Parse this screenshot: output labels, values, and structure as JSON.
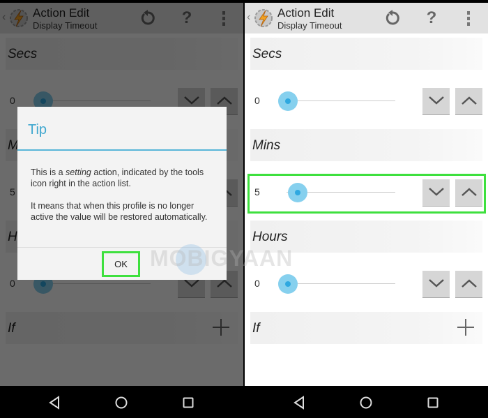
{
  "actionbar": {
    "title": "Action Edit",
    "subtitle": "Display Timeout",
    "back_glyph": "‹",
    "help_glyph": "?"
  },
  "sections": {
    "secs": {
      "label": "Secs",
      "value": "0"
    },
    "mins": {
      "label": "Mins",
      "value": "5"
    },
    "hours": {
      "label": "Hours",
      "value": "0"
    },
    "if": {
      "label": "If"
    }
  },
  "dialog": {
    "title": "Tip",
    "body_pre": "This is a ",
    "body_em": "setting",
    "body_post": " action, indicated by the tools icon right in the action list.",
    "body_2": "It means that when this profile is no longer active the value will be restored automatically.",
    "ok_label": "OK"
  },
  "watermark": {
    "text": "MOBIGYAAN"
  },
  "colors": {
    "accent": "#3fa7cf",
    "slider_thumb": "#86d0ee",
    "highlight": "#3ee03e"
  }
}
